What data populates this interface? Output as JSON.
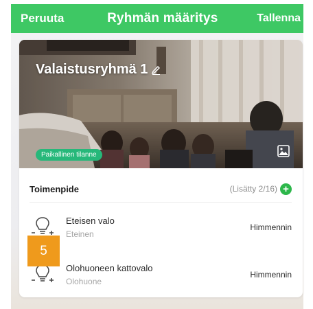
{
  "header": {
    "cancel_label": "Peruuta",
    "title": "Ryhmän määritys",
    "save_label": "Tallenna"
  },
  "group": {
    "name": "Valaistusryhmä 1",
    "badge": "Paikallinen tilanne",
    "edit_icon": "pencil-icon",
    "image_icon": "image-icon"
  },
  "actions": {
    "title": "Toimenpide",
    "added_label": "(Lisätty 2/16)",
    "add_icon": "plus-circle-icon"
  },
  "devices": [
    {
      "name": "Eteisen valo",
      "room": "Eteinen",
      "action": "Himmennin",
      "icon": "dimmer-bulb-icon"
    },
    {
      "name": "Olohuoneen kattovalo",
      "room": "Olohuone",
      "action": "Himmennin",
      "icon": "dimmer-bulb-icon"
    }
  ],
  "marker": {
    "label": "5",
    "color": "#ef9a1c"
  },
  "colors": {
    "accent": "#3ec864",
    "badge": "#26b87a",
    "add": "#2db74b"
  }
}
